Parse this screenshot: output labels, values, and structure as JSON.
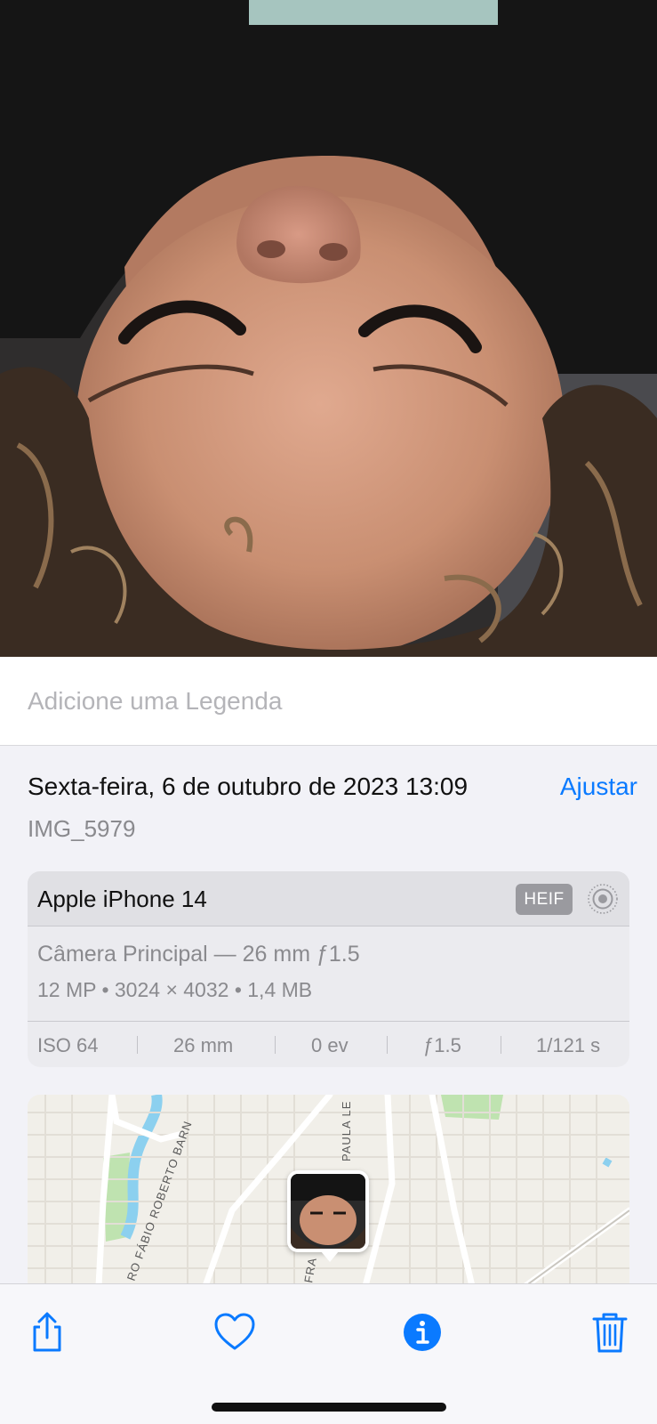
{
  "caption": {
    "placeholder": "Adicione uma Legenda"
  },
  "info": {
    "date_time": "Sexta-feira, 6 de outubro de 2023 13:09",
    "adjust_label": "Ajustar",
    "file_name": "IMG_5979"
  },
  "camera": {
    "device": "Apple iPhone 14",
    "format_badge": "HEIF",
    "lens": "Câmera Principal — 26 mm ƒ1.5",
    "specs": "12 MP  •  3024 × 4032  •  1,4 MB",
    "exif": {
      "iso": "ISO 64",
      "focal_length": "26 mm",
      "exposure_bias": "0 ev",
      "aperture": "ƒ1.5",
      "shutter": "1/121 s"
    }
  },
  "map": {
    "street_labels": [
      "RO FÁBIO ROBERTO BARN",
      "PAULA LE",
      "FRA"
    ]
  },
  "toolbar": {
    "icons": [
      "share-icon",
      "heart-icon",
      "info-icon",
      "trash-icon"
    ]
  },
  "colors": {
    "accent": "#0a7aff",
    "background": "#f2f2f7",
    "secondary_text": "#8a8a8e"
  }
}
